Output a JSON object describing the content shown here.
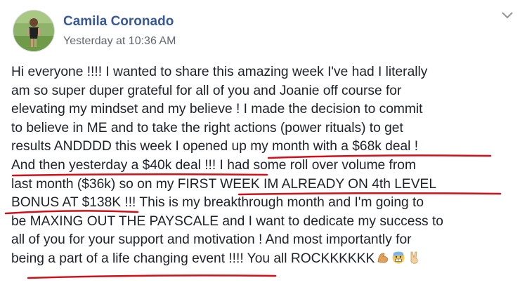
{
  "post": {
    "author": "Camila Coronado",
    "timestamp": "Yesterday at 10:36 AM",
    "lines": [
      "Hi everyone !!!! I wanted to share this amazing week I've had I literally",
      "am so super duper grateful for all of you and Joanie off course for",
      "elevating my mindset and my believe ! I made the decision to commit",
      "to believe in ME and to take the right actions (power rituals) to get",
      "results ANDDDD this week I opened up my month with a $68k deal !",
      "And then yesterday a $40k deal !!! I had some roll over volume from",
      "last month ($36k) so on my FIRST WEEK IM ALREADY ON 4th LEVEL",
      "BONUS AT $138K !!! This is my breakthrough month and I'm going to",
      "be MAXING OUT THE PAYSCALE and I want to dedicate my success to",
      "all of you for your support and motivation ! And most importantly for",
      "being a part of a life changing event !!!! You all ROCKKKKKK"
    ],
    "emojis": [
      "flexed-biceps-icon",
      "grimacing-sweat-face-icon",
      "victory-hand-icon"
    ],
    "underline_color": "#d0101a"
  }
}
